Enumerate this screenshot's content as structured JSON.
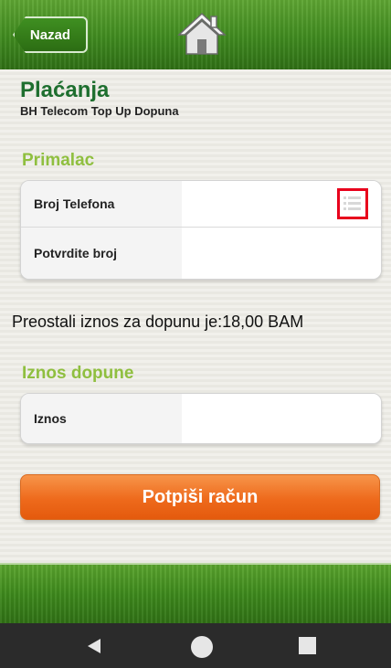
{
  "header": {
    "back_label": "Nazad"
  },
  "page": {
    "title": "Plaćanja",
    "subtitle": "BH Telecom Top Up Dopuna"
  },
  "recipient": {
    "section_title": "Primalac",
    "phone_label": "Broj Telefona",
    "phone_value": "",
    "confirm_label": "Potvrdite broj",
    "confirm_value": ""
  },
  "info": {
    "remaining": "Preostali iznos za dopunu je:18,00 BAM"
  },
  "amount": {
    "section_title": "Iznos dopune",
    "label": "Iznos",
    "value": ""
  },
  "actions": {
    "sign_label": "Potpiši račun"
  },
  "colors": {
    "brand_green": "#3f8a1f",
    "accent_orange": "#ee6a1c",
    "section_green": "#8fbf3f",
    "highlight_red": "#e8001c"
  }
}
